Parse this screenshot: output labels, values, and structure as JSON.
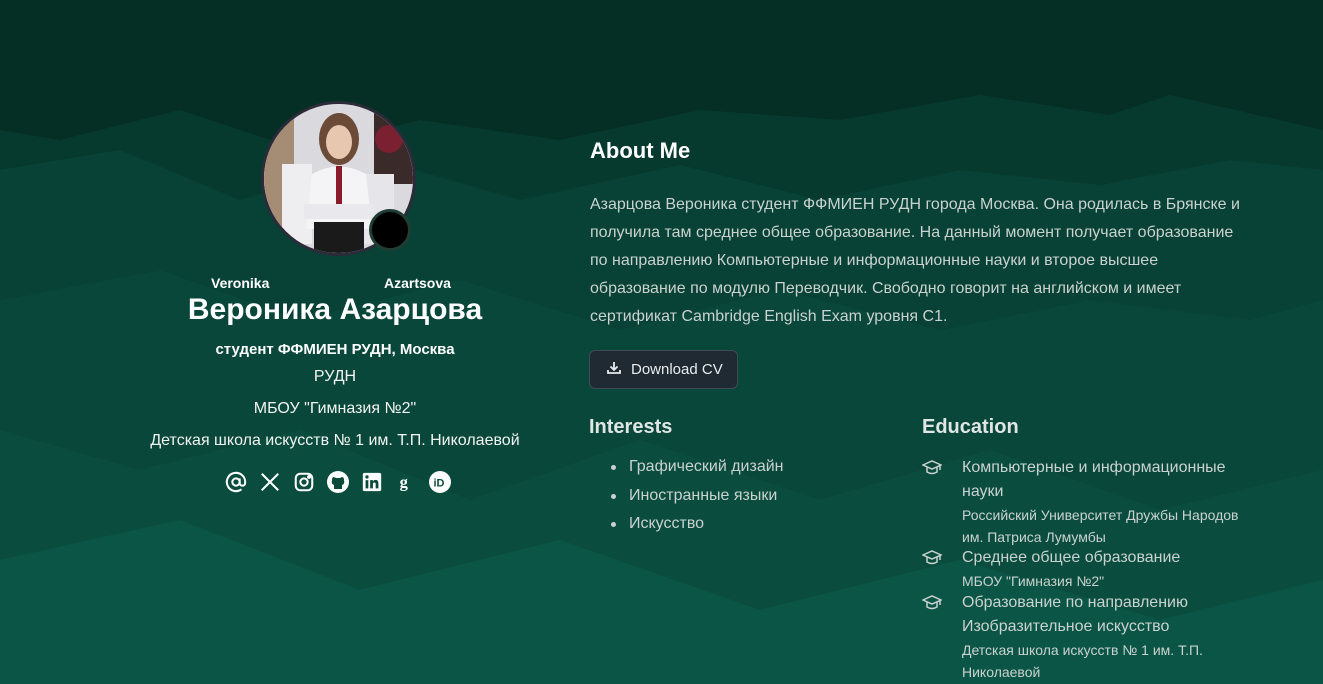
{
  "profile": {
    "first_name_en": "Veronika",
    "last_name_en": "Azartsova",
    "name_ru": "Вероника Азарцова",
    "role": "студент ФФМИЕН РУДН, Москва",
    "organizations": [
      "РУДН",
      "МБОУ \"Гимназия №2\"",
      "Детская школа искусств № 1 им. Т.П. Николаевой"
    ],
    "socials": [
      "at-icon",
      "x-icon",
      "instagram-icon",
      "github-icon",
      "linkedin-icon",
      "google-scholar-icon",
      "orcid-icon"
    ]
  },
  "about": {
    "title": "About Me",
    "text": "Азарцова Вероника студент ФФМИЕН РУДН города Москва. Она родилась в Брянске и получила там среднее общее образование. На данный момент получает образование по направлению Компьютерные и информационные науки и второе высшее образование по модулю Переводчик. Свободно говорит на английском и имеет сертификат Cambridge English Exam уровня С1.",
    "download_label": "Download CV"
  },
  "interests": {
    "title": "Interests",
    "items": [
      "Графический дизайн",
      "Иностранные языки",
      "Искусство"
    ]
  },
  "education": {
    "title": "Education",
    "items": [
      {
        "title": "Компьютерные и информационные науки",
        "institution": "Российский Университет Дружбы Народов им. Патриса Лумумбы"
      },
      {
        "title": "Среднее общее образование",
        "institution": "МБОУ \"Гимназия №2\""
      },
      {
        "title": "Образование по направлению Изобразительное искусство",
        "institution": "Детская школа искусств № 1 им. Т.П. Николаевой"
      }
    ]
  },
  "colors": {
    "background_dark": "#04291f",
    "background_mid": "#0a4a39",
    "background_light": "#0c5c48",
    "button_bg": "#1f2a33"
  }
}
